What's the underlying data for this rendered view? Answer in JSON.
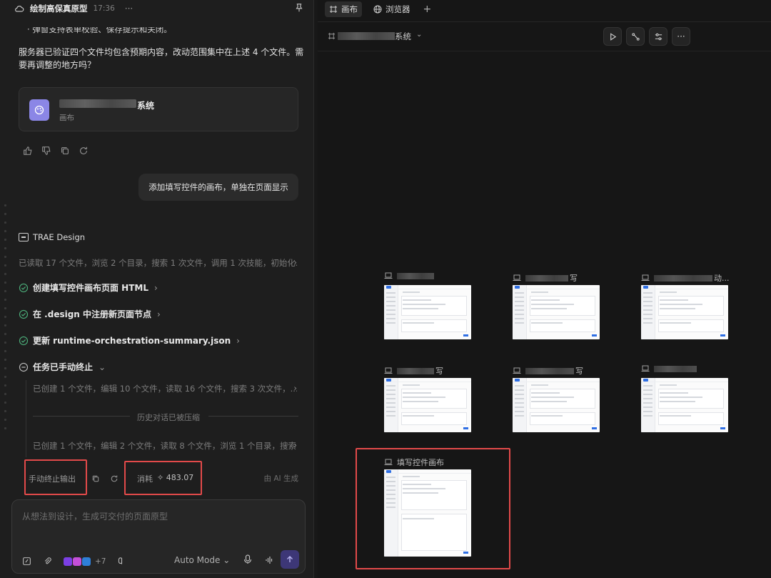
{
  "chat": {
    "title": "绘制高保真原型",
    "time": "17:36",
    "truncated_line": "· 弹窗支持表单校验、保存提示和关闭。",
    "message": "服务器已验证四个文件均包含预期内容，改动范围集中在上述 4 个文件。需要再调整的地方吗？",
    "file_card": {
      "name_suffix": "系统",
      "type": "画布"
    },
    "user_bubble": "添加填写控件的画布，单独在页面显示",
    "agent_name": "TRAE Design",
    "summary": "已读取 17 个文件，浏览 2 个目录，搜索 1 次文件，调用 1 次技能，初始化...",
    "steps": [
      {
        "label": "创建填写控件画布页面 HTML",
        "status": "done"
      },
      {
        "label": "在 .design 中注册新页面节点",
        "status": "done"
      },
      {
        "label": "更新 runtime-orchestration-summary.json",
        "status": "done"
      },
      {
        "label": "任务已手动终止",
        "status": "stopped"
      }
    ],
    "sub_summary_1": "已创建 1 个文件，编辑 10 个文件，读取 16 个文件，搜索 3 次文件，...",
    "compressed_label": "历史对话已被压缩",
    "sub_summary_2": "已创建 1 个文件，编辑 2 个文件，读取 8 个文件，浏览 1 个目录，搜索...",
    "stop_label": "手动终止输出",
    "cost_label": "消耗",
    "cost_value": "483.07",
    "ai_label": "由 AI 生成",
    "input_placeholder": "从想法到设计，生成可交付的页面原型",
    "plus_count": "+7",
    "mode": "Auto Mode"
  },
  "canvas": {
    "tabs": [
      {
        "label": "画布",
        "active": true
      },
      {
        "label": "浏览器",
        "active": false
      }
    ],
    "project_suffix": "系统",
    "nodes": [
      {
        "label": ""
      },
      {
        "label": "写"
      },
      {
        "label": "动..."
      },
      {
        "label": "写"
      },
      {
        "label": "写"
      },
      {
        "label": ""
      },
      {
        "label": "填写控件画布"
      }
    ]
  },
  "colors": {
    "accent": "#8b86e6",
    "success": "#4caf7a",
    "highlight": "#e24a4a",
    "send": "#3d3777"
  }
}
